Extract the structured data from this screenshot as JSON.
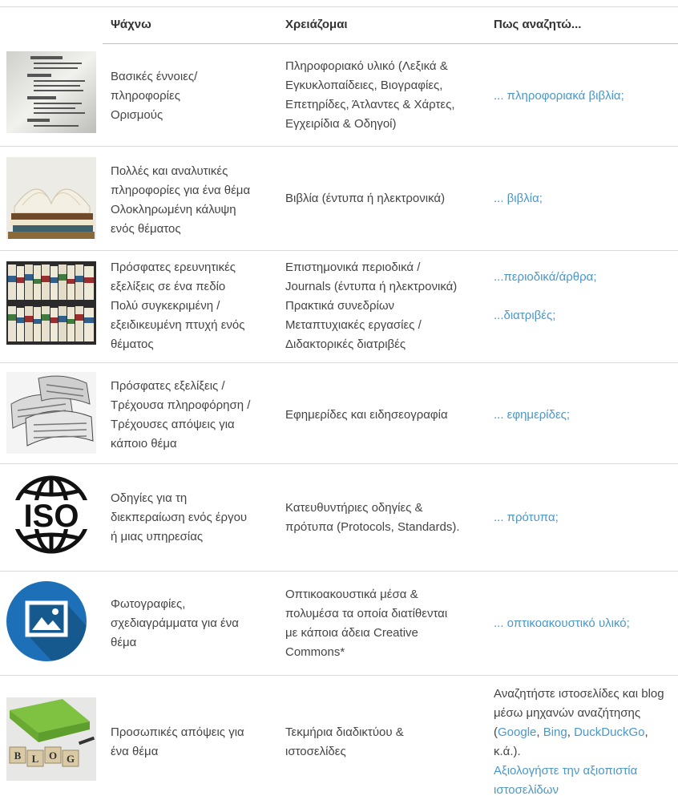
{
  "header": {
    "col1": "Ψάχνω",
    "col2": "Χρειάζομαι",
    "col3": "Πως αναζητώ..."
  },
  "rows": [
    {
      "icon": "dictionary-photo",
      "seek": [
        "Βασικές έννοιες/",
        "πληροφορίες",
        "Ορισμούς"
      ],
      "need": [
        "Πληροφοριακό υλικό (Λεξικά &",
        "Εγκυκλοπαίδειες, Βιογραφίες,",
        "Επετηρίδες, Άτλαντες & Χάρτες,",
        "Εγχειρίδια & Οδηγοί)"
      ],
      "link": "... πληροφοριακά βιβλία;"
    },
    {
      "icon": "books-photo",
      "seek": [
        "Πολλές και αναλυτικές",
        "πληροφορίες για ένα θέμα",
        "Ολοκληρωμένη κάλυψη",
        "ενός θέματος"
      ],
      "need": [
        "Βιβλία (έντυπα ή ηλεκτρονικά)"
      ],
      "link": "... βιβλία;"
    },
    {
      "icon": "journals-photo",
      "seek": [
        "Πρόσφατες ερευνητικές",
        "εξελίξεις σε ένα πεδίο",
        "Πολύ συγκεκριμένη /",
        "εξειδικευμένη πτυχή ενός",
        "θέματος"
      ],
      "need": [
        "Επιστημονικά περιοδικά /",
        "Journals (έντυπα ή ηλεκτρονικά)",
        "Πρακτικά συνεδρίων",
        "Μεταπτυχιακές εργασίες /",
        "Διδακτορικές διατριβές"
      ],
      "link": "...περιοδικά/άρθρα;",
      "link2": "...διατριβές;"
    },
    {
      "icon": "newspapers-photo",
      "seek": [
        "Πρόσφατες εξελίξεις /",
        "Τρέχουσα πληροφόρηση /",
        "Τρέχουσες απόψεις για",
        "κάποιο θέμα"
      ],
      "need": [
        "Εφημερίδες και ειδησεογραφία"
      ],
      "link": "... εφημερίδες;"
    },
    {
      "icon": "iso-globe-icon",
      "iso_text": "ISO",
      "seek": [
        "Οδηγίες για τη",
        "διεκπεραίωση ενός έργου",
        "ή μιας υπηρεσίας"
      ],
      "need": [
        "Κατευθυντήριες οδηγίες &",
        "πρότυπα (Protocols, Standards)."
      ],
      "link": "... πρότυπα;"
    },
    {
      "icon": "image-icon",
      "seek": [
        "Φωτογραφίες,",
        "σχεδιαγράμματα για ένα",
        "θέμα"
      ],
      "need": [
        "Οπτικοακουστικά μέσα &",
        "πολυμέσα τα οποία διατίθενται",
        "με κάποια άδεια Creative",
        "Commons*"
      ],
      "link": "... οπτικοακουστικό υλικό;"
    },
    {
      "icon": "blog-photo",
      "blog_letters": [
        "B",
        "L",
        "O",
        "G"
      ],
      "seek": [
        "Προσωπικές απόψεις για",
        "ένα θέμα"
      ],
      "need": [
        "Τεκμήρια διαδικτύου &",
        "ιστοσελίδες"
      ],
      "search_text_1": "Αναζητήστε ιστοσελίδες και blog",
      "search_text_2": "μέσω μηχανών αναζήτησης",
      "search_open": "(",
      "engines": [
        "Google",
        "Bing",
        "DuckDuckGo"
      ],
      "sep": ", ",
      "search_close": ",",
      "etc": "κ.ά.).",
      "evaluate_1": "Αξιολογήστε την αξιοπιστία",
      "evaluate_2": "ιστοσελίδων"
    }
  ]
}
